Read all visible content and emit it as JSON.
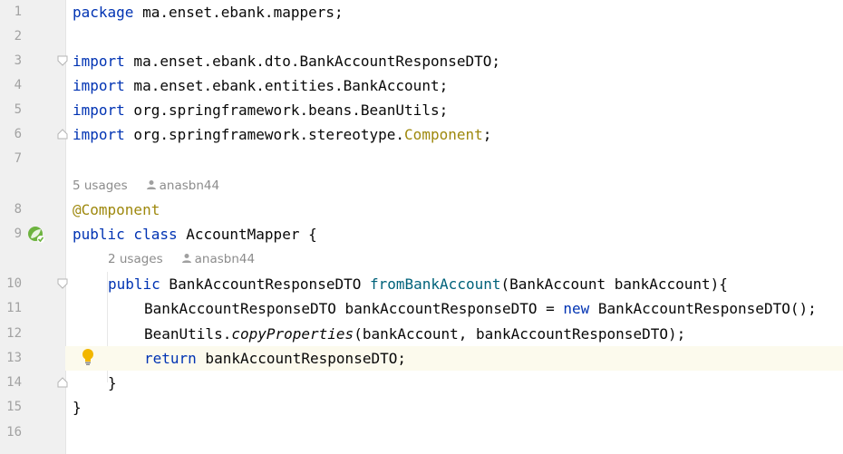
{
  "editor": {
    "lines": [
      {
        "n": "1"
      },
      {
        "n": "2"
      },
      {
        "n": "3"
      },
      {
        "n": "4"
      },
      {
        "n": "5"
      },
      {
        "n": "6"
      },
      {
        "n": "7"
      },
      {
        "n": "8"
      },
      {
        "n": "9"
      },
      {
        "n": "10"
      },
      {
        "n": "11"
      },
      {
        "n": "12"
      },
      {
        "n": "13"
      },
      {
        "n": "14"
      },
      {
        "n": "15"
      },
      {
        "n": "16"
      }
    ],
    "code": {
      "l1_kw": "package",
      "l1_rest": " ma.enset.ebank.mappers;",
      "l3_kw": "import",
      "l3_rest": " ma.enset.ebank.dto.BankAccountResponseDTO;",
      "l4_kw": "import",
      "l4_rest": " ma.enset.ebank.entities.BankAccount;",
      "l5_kw": "import",
      "l5_rest": " org.springframework.beans.BeanUtils;",
      "l6_kw": "import",
      "l6_a": " org.springframework.stereotype.",
      "l6_ann": "Component",
      "l6_b": ";",
      "l8_ann": "@Component",
      "l9_kw": "public class",
      "l9_rest": " AccountMapper {",
      "l10_kw": "public",
      "l10_a": " BankAccountResponseDTO ",
      "l10_fn": "fromBankAccount",
      "l10_b": "(BankAccount bankAccount){",
      "l11_a": "BankAccountResponseDTO bankAccountResponseDTO = ",
      "l11_kw": "new",
      "l11_b": " BankAccountResponseDTO();",
      "l12_a": "BeanUtils.",
      "l12_it": "copyProperties",
      "l12_b": "(bankAccount, bankAccountResponseDTO);",
      "l13_kw": "return",
      "l13_rest": " bankAccountResponseDTO;",
      "l14": "}",
      "l15": "}"
    },
    "hints": {
      "class_usages": "5 usages",
      "class_author": "anasbn44",
      "method_usages": "2 usages",
      "method_author": "anasbn44"
    },
    "icons": {
      "gutter_line9": "spring-bean-icon",
      "gutter_line13": "lightbulb-icon",
      "fold": "fold-marker-icon",
      "author": "person-icon"
    },
    "colors": {
      "keyword": "#0033b3",
      "annotation": "#9e880d",
      "method": "#00627a",
      "current_line": "#fcfaed"
    }
  }
}
